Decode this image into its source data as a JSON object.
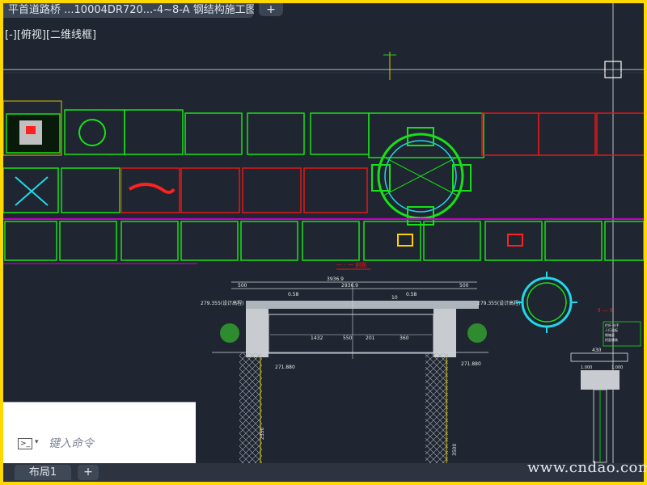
{
  "window": {
    "doc_tab_title": "平首道路桥 ...10004DR720...-4~8-A 钢结构施工图*",
    "new_tab": "+",
    "viewport_label": "[-][俯视][二维线框]"
  },
  "drawing": {
    "section_title_1": "一 - 一 剖面",
    "section_title_2": "Ⅱ — Ⅱ",
    "dim_total_top": "3936.9",
    "dim_total_inner": "2936.9",
    "dim_left_500": "500",
    "dim_right_500": "500",
    "dim_058_left": "0.58",
    "dim_058_right": "0.58",
    "dim_10": "10",
    "dim_1432": "1432",
    "dim_201": "201",
    "dim_360": "360",
    "dim_550": "550",
    "elev_left": "279.355(设计高程)",
    "elev_right": "279.355(设计高程)",
    "elev_bottom_left": "271.880",
    "elev_bottom_right": "271.880",
    "dim_2350": "2350",
    "dim_3500": "3500",
    "dim_430": "430",
    "dim_1000_left": "1.000",
    "dim_1000_right": "1.000",
    "rail_note_lines": [
      "栏杆-扶手",
      "人行道板",
      "钢箱梁",
      "桥面铺装"
    ]
  },
  "command": {
    "prompt_icon": ">_",
    "dropdown_arrow": "▾",
    "placeholder": "键入命令"
  },
  "layout": {
    "tab_label": "布局1",
    "add_label": "+"
  },
  "watermark": "www.cndao.com",
  "colors": {
    "background": "#1f2631",
    "frame": "#ffd800",
    "sheet_green": "#18e018",
    "sheet_red": "#e01818",
    "sheet_magenta": "#c400c4",
    "accent_cyan": "#22d6e8"
  }
}
